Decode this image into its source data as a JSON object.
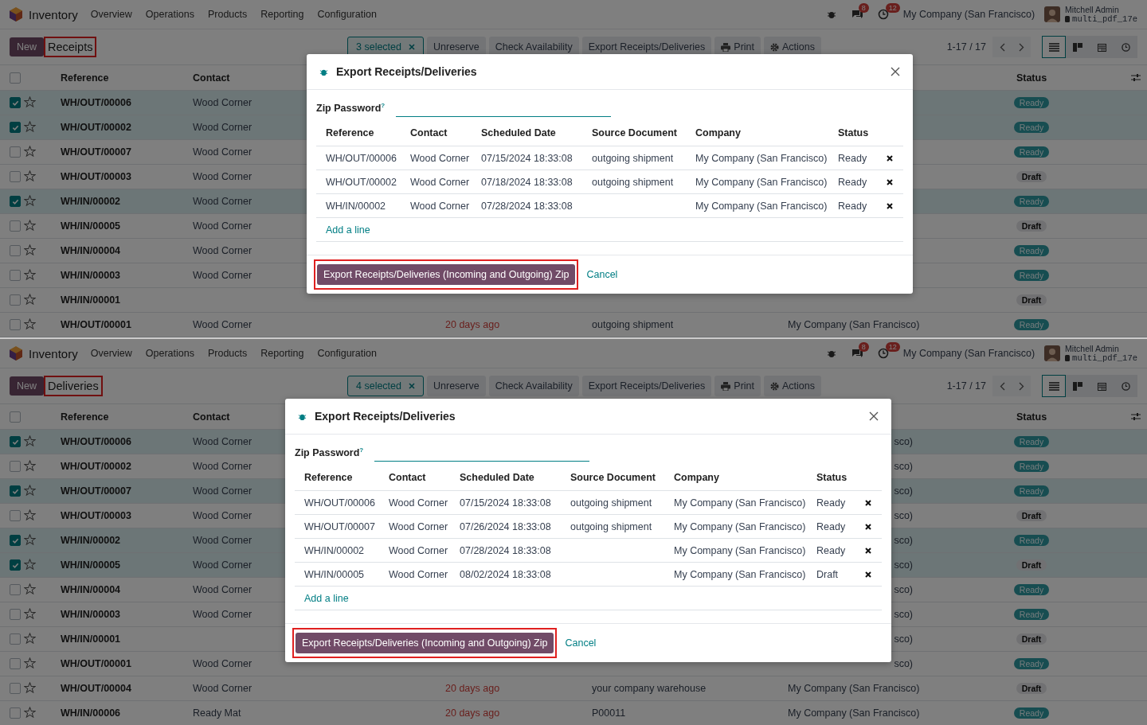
{
  "screens": [
    {
      "navbar": {
        "app": "Inventory",
        "menus": [
          "Overview",
          "Operations",
          "Products",
          "Reporting",
          "Configuration"
        ],
        "messages_count": "8",
        "activities_count": "12",
        "company": "My Company (San Francisco)",
        "user": "Mitchell Admin",
        "database": "multi_pdf_17e"
      },
      "control_bar": {
        "new_button": "New",
        "title": "Receipts",
        "title_highlighted": true,
        "selection": "3 selected",
        "actions": [
          {
            "label": "Unreserve",
            "kind": "plain"
          },
          {
            "label": "Check Availability",
            "kind": "plain"
          },
          {
            "label": "Export Receipts/Deliveries",
            "kind": "plain"
          },
          {
            "label": "Print",
            "kind": "print"
          },
          {
            "label": "Actions",
            "kind": "menu"
          }
        ],
        "pager": "1-17 / 17",
        "views": [
          {
            "kind": "list",
            "selected": true
          },
          {
            "kind": "kanban",
            "selected": false
          },
          {
            "kind": "calendar",
            "selected": false
          },
          {
            "kind": "activity",
            "selected": false
          }
        ]
      },
      "list": {
        "all_selected": false,
        "columns": {
          "reference": "Reference",
          "contact": "Contact",
          "status": "Status"
        },
        "rows": [
          {
            "selected": true,
            "reference": "WH/OUT/00006",
            "contact": "Wood Corner",
            "status": {
              "label": "Ready",
              "kind": "ready"
            }
          },
          {
            "selected": true,
            "reference": "WH/OUT/00002",
            "contact": "Wood Corner",
            "status": {
              "label": "Ready",
              "kind": "ready"
            }
          },
          {
            "selected": false,
            "reference": "WH/OUT/00007",
            "contact": "Wood Corner",
            "status": {
              "label": "Ready",
              "kind": "ready"
            }
          },
          {
            "selected": false,
            "reference": "WH/OUT/00003",
            "contact": "Wood Corner",
            "status": {
              "label": "Draft",
              "kind": "draft"
            }
          },
          {
            "selected": true,
            "reference": "WH/IN/00002",
            "contact": "Wood Corner",
            "status": {
              "label": "Ready",
              "kind": "ready"
            }
          },
          {
            "selected": false,
            "reference": "WH/IN/00005",
            "contact": "Wood Corner",
            "status": {
              "label": "Draft",
              "kind": "draft"
            }
          },
          {
            "selected": false,
            "reference": "WH/IN/00004",
            "contact": "Wood Corner",
            "status": {
              "label": "Ready",
              "kind": "ready"
            }
          },
          {
            "selected": false,
            "reference": "WH/IN/00003",
            "contact": "Wood Corner",
            "status": {
              "label": "Ready",
              "kind": "ready"
            }
          },
          {
            "selected": false,
            "reference": "WH/IN/00001",
            "status": {
              "label": "Draft",
              "kind": "draft"
            }
          },
          {
            "selected": false,
            "reference": "WH/OUT/00001",
            "contact": "Wood Corner",
            "scheduled": "20 days ago",
            "source": "outgoing shipment",
            "company": "My Company (San Francisco)",
            "status": {
              "label": "Ready",
              "kind": "ready"
            }
          }
        ]
      },
      "dialog": {
        "title": "Export Receipts/Deliveries",
        "password_label": "Zip Password",
        "help_mark": "?",
        "columns": [
          "Reference",
          "Contact",
          "Scheduled Date",
          "Source Document",
          "Company",
          "Status"
        ],
        "lines": [
          {
            "reference": "WH/OUT/00006",
            "contact": "Wood Corner",
            "scheduled": "07/15/2024 18:33:08",
            "source": "outgoing shipment",
            "company": "My Company (San Francisco)",
            "status": "Ready"
          },
          {
            "reference": "WH/OUT/00002",
            "contact": "Wood Corner",
            "scheduled": "07/18/2024 18:33:08",
            "source": "outgoing shipment",
            "company": "My Company (San Francisco)",
            "status": "Ready"
          },
          {
            "reference": "WH/IN/00002",
            "contact": "Wood Corner",
            "scheduled": "07/28/2024 18:33:08",
            "company": "My Company (San Francisco)",
            "status": "Ready"
          }
        ],
        "add_line": "Add a line",
        "confirm": "Export Receipts/Deliveries (Incoming and Outgoing) Zip",
        "confirm_highlighted": true,
        "cancel": "Cancel"
      }
    },
    {
      "navbar": {
        "app": "Inventory",
        "menus": [
          "Overview",
          "Operations",
          "Products",
          "Reporting",
          "Configuration"
        ],
        "messages_count": "8",
        "activities_count": "12",
        "company": "My Company (San Francisco)",
        "user": "Mitchell Admin",
        "database": "multi_pdf_17e"
      },
      "control_bar": {
        "new_button": "New",
        "title": "Deliveries",
        "title_highlighted": true,
        "selection": "4 selected",
        "actions": [
          {
            "label": "Unreserve",
            "kind": "plain"
          },
          {
            "label": "Check Availability",
            "kind": "plain"
          },
          {
            "label": "Export Receipts/Deliveries",
            "kind": "plain"
          },
          {
            "label": "Print",
            "kind": "print"
          },
          {
            "label": "Actions",
            "kind": "menu"
          }
        ],
        "pager": "1-17 / 17",
        "views": [
          {
            "kind": "list",
            "selected": true
          },
          {
            "kind": "kanban",
            "selected": false
          },
          {
            "kind": "calendar",
            "selected": false
          },
          {
            "kind": "activity",
            "selected": false
          }
        ]
      },
      "list": {
        "all_selected": false,
        "columns": {
          "reference": "Reference",
          "contact": "Contact",
          "status": "Status"
        },
        "rows": [
          {
            "selected": true,
            "reference": "WH/OUT/00006",
            "contact": "Wood Corner",
            "company": "sco)",
            "status": {
              "label": "Ready",
              "kind": "ready"
            }
          },
          {
            "selected": false,
            "reference": "WH/OUT/00002",
            "contact": "Wood Corner",
            "company": "sco)",
            "status": {
              "label": "Ready",
              "kind": "ready"
            }
          },
          {
            "selected": true,
            "reference": "WH/OUT/00007",
            "contact": "Wood Corner",
            "company": "sco)",
            "status": {
              "label": "Ready",
              "kind": "ready"
            }
          },
          {
            "selected": false,
            "reference": "WH/OUT/00003",
            "contact": "Wood Corner",
            "company": "sco)",
            "status": {
              "label": "Draft",
              "kind": "draft"
            }
          },
          {
            "selected": true,
            "reference": "WH/IN/00002",
            "contact": "Wood Corner",
            "company": "sco)",
            "status": {
              "label": "Ready",
              "kind": "ready"
            }
          },
          {
            "selected": true,
            "reference": "WH/IN/00005",
            "contact": "Wood Corner",
            "company": "sco)",
            "status": {
              "label": "Draft",
              "kind": "draft"
            }
          },
          {
            "selected": false,
            "reference": "WH/IN/00004",
            "contact": "Wood Corner",
            "company": "sco)",
            "status": {
              "label": "Ready",
              "kind": "ready"
            }
          },
          {
            "selected": false,
            "reference": "WH/IN/00003",
            "contact": "Wood Corner",
            "company": "sco)",
            "status": {
              "label": "Ready",
              "kind": "ready"
            }
          },
          {
            "selected": false,
            "reference": "WH/IN/00001",
            "company": "sco)",
            "status": {
              "label": "Draft",
              "kind": "draft"
            }
          },
          {
            "selected": false,
            "reference": "WH/OUT/00001",
            "contact": "Wood Corner",
            "company": "sco)",
            "status": {
              "label": "Ready",
              "kind": "ready"
            }
          },
          {
            "selected": false,
            "reference": "WH/OUT/00004",
            "contact": "Wood Corner",
            "scheduled": "20 days ago",
            "source": "your company warehouse",
            "company": "My Company (San Francisco)",
            "status": {
              "label": "Draft",
              "kind": "draft"
            }
          },
          {
            "selected": false,
            "reference": "WH/IN/00006",
            "contact": "Ready Mat",
            "scheduled": "20 days ago",
            "source": "P00011",
            "company": "My Company (San Francisco)",
            "status": {
              "label": "Ready",
              "kind": "ready"
            }
          }
        ]
      },
      "dialog": {
        "title": "Export Receipts/Deliveries",
        "password_label": "Zip Password",
        "help_mark": "?",
        "columns": [
          "Reference",
          "Contact",
          "Scheduled Date",
          "Source Document",
          "Company",
          "Status"
        ],
        "lines": [
          {
            "reference": "WH/OUT/00006",
            "contact": "Wood Corner",
            "scheduled": "07/15/2024 18:33:08",
            "source": "outgoing shipment",
            "company": "My Company (San Francisco)",
            "status": "Ready"
          },
          {
            "reference": "WH/OUT/00007",
            "contact": "Wood Corner",
            "scheduled": "07/26/2024 18:33:08",
            "source": "outgoing shipment",
            "company": "My Company (San Francisco)",
            "status": "Ready"
          },
          {
            "reference": "WH/IN/00002",
            "contact": "Wood Corner",
            "scheduled": "07/28/2024 18:33:08",
            "company": "My Company (San Francisco)",
            "status": "Ready"
          },
          {
            "reference": "WH/IN/00005",
            "contact": "Wood Corner",
            "scheduled": "08/02/2024 18:33:08",
            "company": "My Company (San Francisco)",
            "status": "Draft"
          }
        ],
        "add_line": "Add a line",
        "confirm": "Export Receipts/Deliveries (Incoming and Outgoing) Zip",
        "confirm_highlighted": true,
        "cancel": "Cancel"
      }
    }
  ]
}
